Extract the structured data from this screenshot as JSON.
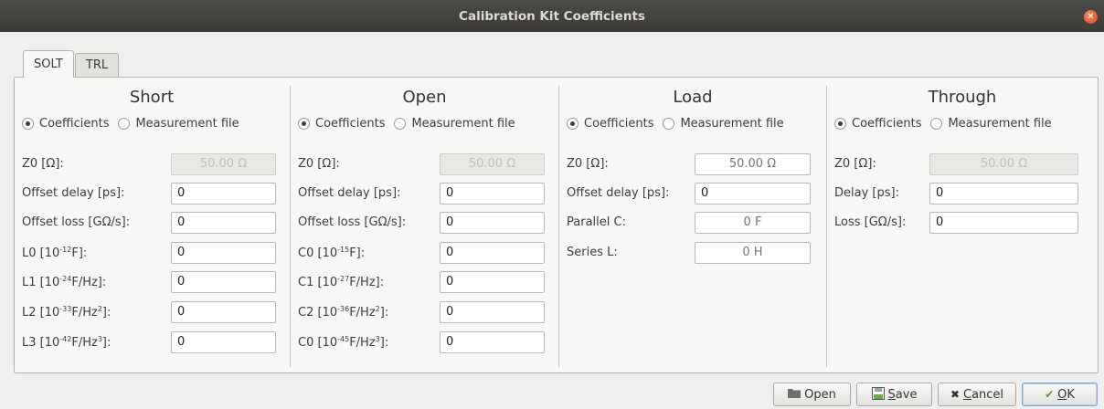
{
  "window": {
    "title": "Calibration Kit Coefficients"
  },
  "tabs": [
    {
      "label": "SOLT"
    },
    {
      "label": "TRL"
    }
  ],
  "radio": {
    "coefficients": "Coefficients",
    "measurement_file": "Measurement file"
  },
  "short": {
    "title": "Short",
    "z0_label": "Z0 [Ω]:",
    "z0_value": "50.00 Ω",
    "offset_delay_label": "Offset delay [ps]:",
    "offset_delay_value": "0",
    "offset_loss_label": "Offset loss [GΩ/s]:",
    "offset_loss_value": "0",
    "l0_label_prefix": "L0 [10",
    "l0_exp": "-12",
    "l0_label_suffix": "F]:",
    "l0_value": "0",
    "l1_label_prefix": "L1 [10",
    "l1_exp": "-24",
    "l1_label_suffix": "F/Hz]:",
    "l1_value": "0",
    "l2_label_prefix": "L2 [10",
    "l2_exp": "-33",
    "l2_label_mid": "F/Hz",
    "l2_exp2": "2",
    "l2_label_suffix": "]:",
    "l2_value": "0",
    "l3_label_prefix": "L3 [10",
    "l3_exp": "-42",
    "l3_label_mid": "F/Hz",
    "l3_exp2": "3",
    "l3_label_suffix": "]:",
    "l3_value": "0"
  },
  "open": {
    "title": "Open",
    "z0_label": "Z0 [Ω]:",
    "z0_value": "50.00 Ω",
    "offset_delay_label": "Offset delay [ps]:",
    "offset_delay_value": "0",
    "offset_loss_label": "Offset loss [GΩ/s]:",
    "offset_loss_value": "0",
    "c0_label_prefix": "C0 [10",
    "c0_exp": "-15",
    "c0_label_suffix": "F]:",
    "c0_value": "0",
    "c1_label_prefix": "C1 [10",
    "c1_exp": "-27",
    "c1_label_suffix": "F/Hz]:",
    "c1_value": "0",
    "c2_label_prefix": "C2 [10",
    "c2_exp": "-36",
    "c2_label_mid": "F/Hz",
    "c2_exp2": "2",
    "c2_label_suffix": "]:",
    "c2_value": "0",
    "c3_label_prefix": "C0 [10",
    "c3_exp": "-45",
    "c3_label_mid": "F/Hz",
    "c3_exp2": "3",
    "c3_label_suffix": "]:",
    "c3_value": "0"
  },
  "load": {
    "title": "Load",
    "z0_label": "Z0 [Ω]:",
    "z0_value": "50.00 Ω",
    "offset_delay_label": "Offset delay [ps]:",
    "offset_delay_value": "0",
    "parallel_c_label": "Parallel C:",
    "parallel_c_value": "0 F",
    "series_l_label": "Series L:",
    "series_l_value": "0 H"
  },
  "through": {
    "title": "Through",
    "z0_label": "Z0 [Ω]:",
    "z0_value": "50.00 Ω",
    "delay_label": "Delay [ps]:",
    "delay_value": "0",
    "loss_label": "Loss [GΩ/s]:",
    "loss_value": "0"
  },
  "buttons": {
    "open": "Open",
    "save_first": "S",
    "save_rest": "ave",
    "cancel_first": "C",
    "cancel_rest": "ancel",
    "ok_first": "O",
    "ok_rest": "K"
  },
  "icons": {
    "open": "folder-icon",
    "save": "save-icon",
    "cancel": "cancel-icon",
    "ok": "checkmark-icon",
    "close": "close-icon"
  }
}
